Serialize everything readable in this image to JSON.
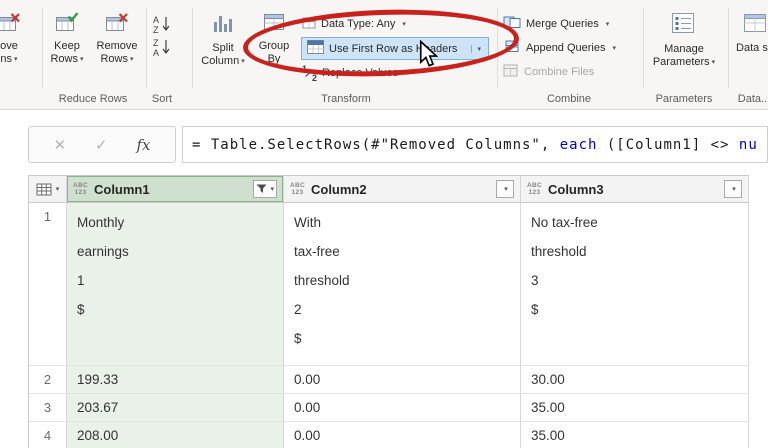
{
  "ribbon": {
    "partial_remove_columns": {
      "line1": "ove",
      "line2": "ns"
    },
    "keep_rows": "Keep Rows",
    "remove_rows": "Remove Rows",
    "reduce_rows_group_label": "Reduce Rows",
    "sort_group_label": "Sort",
    "split_column": "Split Column",
    "group_by": "Group By",
    "data_type": "Data Type: Any",
    "use_first_row_as_headers": "Use First Row as Headers",
    "replace_values": "Replace Values",
    "transform_group_label": "Transform",
    "merge_queries": "Merge Queries",
    "append_queries": "Append Queries",
    "combine_files": "Combine Files",
    "combine_group_label": "Combine",
    "manage_parameters": "Manage Parameters",
    "parameters_group_label": "Parameters",
    "dataset": "Data se",
    "data_group_label": "Data..."
  },
  "formula_bar": {
    "fx_label": "fx",
    "formula": {
      "part1": "= Table.SelectRows(#\"Removed Columns\", ",
      "keyword_each": "each",
      "part2": " ([Column1] <> ",
      "keyword_null": "nu"
    }
  },
  "icons": {
    "chevron_down": "▾",
    "cancel": "✕",
    "check": "✓",
    "sort_a": "A",
    "sort_z": "Z",
    "one": "1",
    "two": "2",
    "abc": "ABC",
    "numbers": "123"
  },
  "table": {
    "columns": [
      "Column1",
      "Column2",
      "Column3"
    ],
    "rows": [
      {
        "num": "1",
        "col1_lines": [
          "Monthly",
          "earnings",
          "1",
          "$"
        ],
        "col2_lines": [
          "With",
          "tax-free",
          "threshold",
          "2",
          "$"
        ],
        "col3_lines": [
          "No tax-free",
          "threshold",
          "3",
          "$"
        ]
      },
      {
        "num": "2",
        "col1": "199.33",
        "col2": "0.00",
        "col3": "30.00"
      },
      {
        "num": "3",
        "col1": "203.67",
        "col2": "0.00",
        "col3": "35.00"
      },
      {
        "num": "4",
        "col1": "208.00",
        "col2": "0.00",
        "col3": "35.00"
      }
    ]
  },
  "colors": {
    "selected_column_header": "#cfe0cf",
    "selected_column_cell": "#e9f1e9",
    "hover_highlight_blue": "#cde3f6",
    "annotation_red": "#c9211c",
    "keyword_blue": "#0000cc"
  }
}
